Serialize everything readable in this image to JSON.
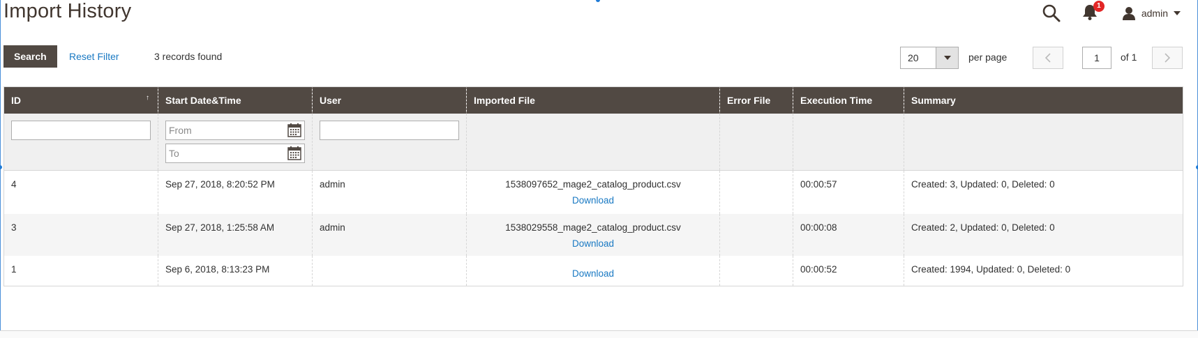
{
  "header": {
    "title": "Import History",
    "notification_count": "1",
    "user_name": "admin"
  },
  "toolbar": {
    "search_label": "Search",
    "reset_filter_label": "Reset Filter",
    "records_found": "3 records found",
    "per_page_value": "20",
    "per_page_label": "per page",
    "current_page": "1",
    "page_of": "of 1"
  },
  "grid": {
    "columns": [
      "ID",
      "Start Date&Time",
      "User",
      "Imported File",
      "Error File",
      "Execution Time",
      "Summary"
    ],
    "filters": {
      "date_from_placeholder": "From",
      "date_to_placeholder": "To"
    },
    "rows": [
      {
        "id": "4",
        "start": "Sep 27, 2018, 8:20:52 PM",
        "user": "admin",
        "file": "1538097652_mage2_catalog_product.csv",
        "download": "Download",
        "error_file": "",
        "exec_time": "00:00:57",
        "summary": "Created: 3, Updated: 0, Deleted: 0"
      },
      {
        "id": "3",
        "start": "Sep 27, 2018, 1:25:58 AM",
        "user": "admin",
        "file": "1538029558_mage2_catalog_product.csv",
        "download": "Download",
        "error_file": "",
        "exec_time": "00:00:08",
        "summary": "Created: 2, Updated: 0, Deleted: 0"
      },
      {
        "id": "1",
        "start": "Sep 6, 2018, 8:13:23 PM",
        "user": "",
        "file": "",
        "download": "Download",
        "error_file": "",
        "exec_time": "00:00:52",
        "summary": "Created: 1994, Updated: 0, Deleted: 0"
      }
    ]
  },
  "colors": {
    "header_bg": "#514943",
    "link": "#1979c3",
    "badge": "#e22626"
  }
}
